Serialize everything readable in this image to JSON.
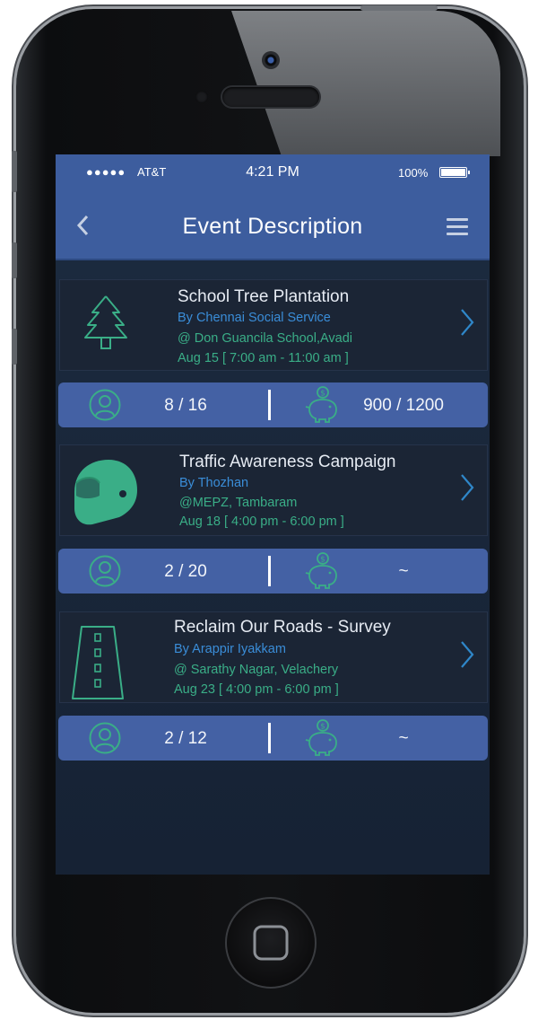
{
  "status_bar": {
    "signal": "●●●●●",
    "carrier": "AT&T",
    "time": "4:21 PM",
    "battery": "100%"
  },
  "nav": {
    "title": "Event Description",
    "back_icon": "chevron-left-icon",
    "menu_icon": "hamburger-menu-icon"
  },
  "colors": {
    "header": "#3d5d9e",
    "stat_bar": "#4461a4",
    "accent_green": "#3aae87",
    "accent_blue": "#3a8dd8",
    "background": "#1c2b40"
  },
  "events": [
    {
      "icon": "tree-icon",
      "title": "School Tree Plantation",
      "organizer": "By Chennai Social Service",
      "location": "@ Don Guancila School,Avadi",
      "time": "Aug 15 [ 7:00 am - 11:00 am ]",
      "volunteers": "8 / 16",
      "funds": "900 / 1200"
    },
    {
      "icon": "helmet-icon",
      "title": "Traffic Awareness Campaign",
      "organizer": "By Thozhan",
      "location": "@MEPZ, Tambaram",
      "time": "Aug 18 [ 4:00 pm - 6:00 pm ]",
      "volunteers": "2 / 20",
      "funds": "~"
    },
    {
      "icon": "road-icon",
      "title": "Reclaim Our Roads - Survey",
      "organizer": "By Arappir Iyakkam",
      "location": "@ Sarathy Nagar, Velachery",
      "time": "Aug 23 [ 4:00 pm - 6:00 pm ]",
      "volunteers": "2 / 12",
      "funds": "~"
    }
  ]
}
